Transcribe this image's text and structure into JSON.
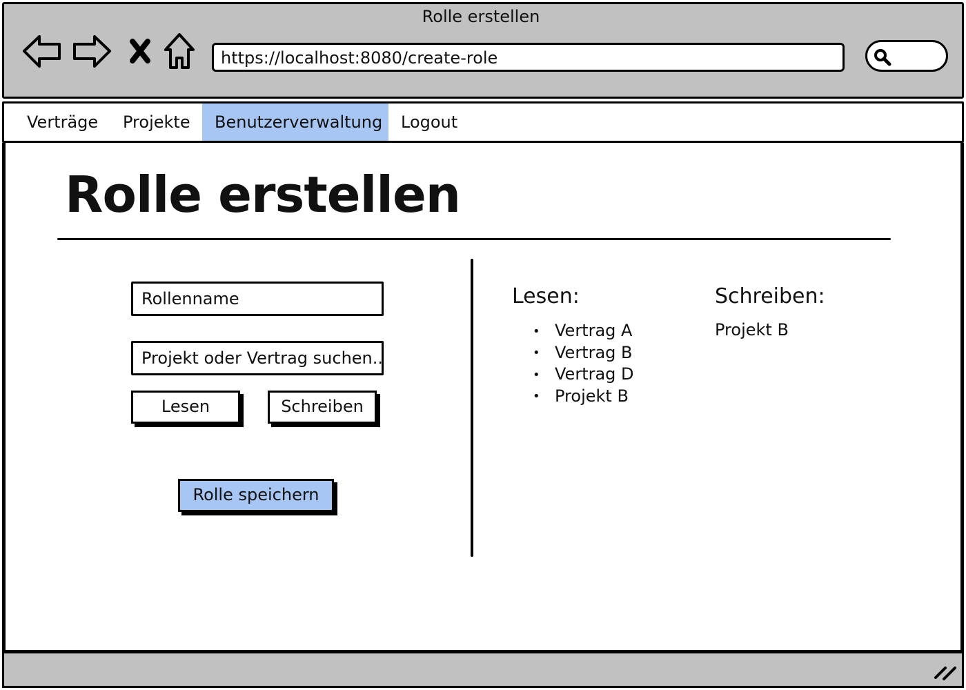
{
  "window": {
    "title": "Rolle erstellen"
  },
  "browser": {
    "url": "https://localhost:8080/create-role"
  },
  "menu": {
    "items": [
      {
        "label": "Verträge",
        "active": false
      },
      {
        "label": "Projekte",
        "active": false
      },
      {
        "label": "Benutzerverwaltung",
        "active": true
      },
      {
        "label": "Logout",
        "active": false
      }
    ]
  },
  "page": {
    "title": "Rolle erstellen"
  },
  "form": {
    "role_name_field": "Rollenname",
    "search_field": "Projekt oder Vertrag suchen..",
    "read_button": "Lesen",
    "write_button": "Schreiben",
    "save_button": "Rolle speichern"
  },
  "permissions": {
    "read_heading": "Lesen:",
    "read_items": [
      "Vertrag A",
      "Vertrag B",
      "Vertrag D",
      "Projekt B"
    ],
    "write_heading": "Schreiben:",
    "write_items": [
      "Projekt B"
    ]
  },
  "colors": {
    "chrome": "#c1c1c1",
    "accent": "#a7c6f3"
  },
  "icons": [
    "back-arrow-icon",
    "forward-arrow-icon",
    "stop-icon",
    "home-icon",
    "search-icon",
    "resize-handle-icon"
  ]
}
